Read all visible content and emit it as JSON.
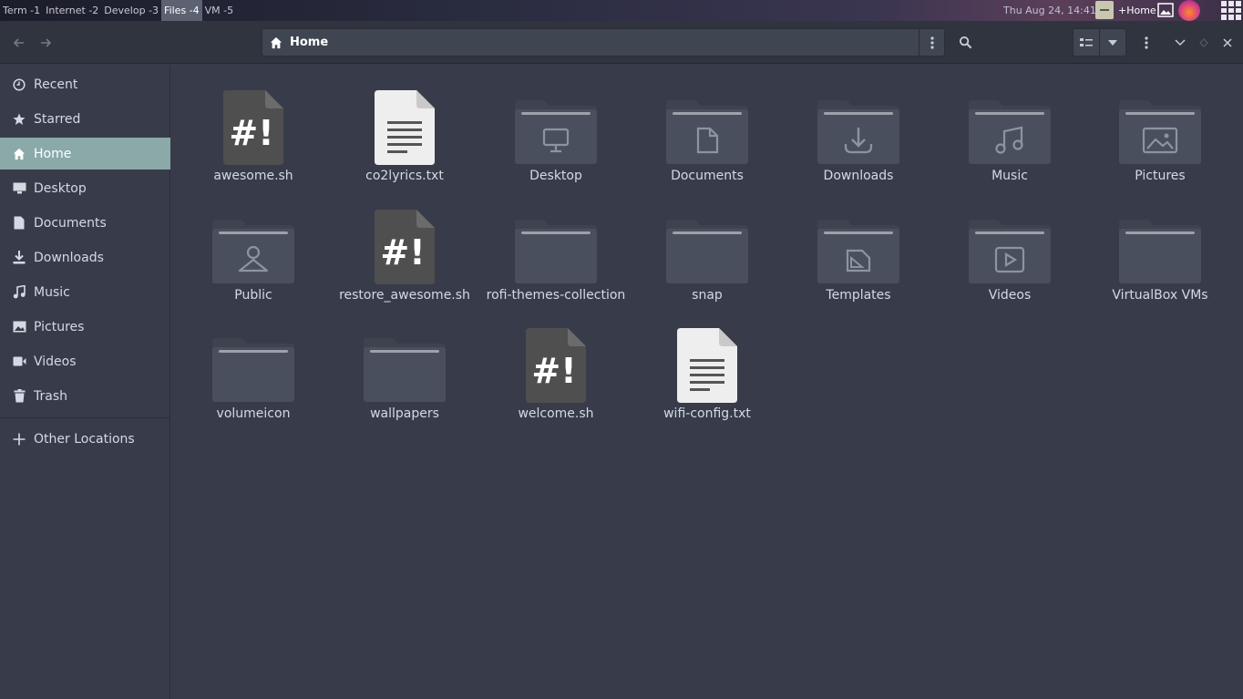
{
  "topbar": {
    "workspaces": [
      "Term -1",
      "Internet -2",
      "Develop -3",
      "Files -4",
      "VM -5"
    ],
    "active_workspace": 3,
    "clock": "Thu Aug 24, 14:41",
    "tray_title": "+Home"
  },
  "header": {
    "path": "Home"
  },
  "sidebar": {
    "items": [
      {
        "label": "Recent",
        "icon": "clock-icon"
      },
      {
        "label": "Starred",
        "icon": "star-icon"
      },
      {
        "label": "Home",
        "icon": "home-icon",
        "active": true
      },
      {
        "label": "Desktop",
        "icon": "desktop-icon"
      },
      {
        "label": "Documents",
        "icon": "document-icon"
      },
      {
        "label": "Downloads",
        "icon": "download-icon"
      },
      {
        "label": "Music",
        "icon": "music-icon"
      },
      {
        "label": "Pictures",
        "icon": "picture-icon"
      },
      {
        "label": "Videos",
        "icon": "video-icon"
      },
      {
        "label": "Trash",
        "icon": "trash-icon"
      }
    ],
    "other_locations": "Other Locations"
  },
  "files": [
    {
      "name": "awesome.sh",
      "kind": "script"
    },
    {
      "name": "co2lyrics.txt",
      "kind": "text"
    },
    {
      "name": "Desktop",
      "kind": "folder",
      "emblem": "desktop"
    },
    {
      "name": "Documents",
      "kind": "folder",
      "emblem": "document"
    },
    {
      "name": "Downloads",
      "kind": "folder",
      "emblem": "download"
    },
    {
      "name": "Music",
      "kind": "folder",
      "emblem": "music"
    },
    {
      "name": "Pictures",
      "kind": "folder",
      "emblem": "picture"
    },
    {
      "name": "Public",
      "kind": "folder",
      "emblem": "public"
    },
    {
      "name": "restore_awesome.sh",
      "kind": "script"
    },
    {
      "name": "rofi-themes-collection",
      "kind": "folder"
    },
    {
      "name": "snap",
      "kind": "folder"
    },
    {
      "name": "Templates",
      "kind": "folder",
      "emblem": "template"
    },
    {
      "name": "Videos",
      "kind": "folder",
      "emblem": "video"
    },
    {
      "name": "VirtualBox VMs",
      "kind": "folder"
    },
    {
      "name": "volumeicon",
      "kind": "folder"
    },
    {
      "name": "wallpapers",
      "kind": "folder"
    },
    {
      "name": "welcome.sh",
      "kind": "script"
    },
    {
      "name": "wifi-config.txt",
      "kind": "text"
    }
  ],
  "colors": {
    "background": "#383c4a",
    "header": "#2f343f",
    "sidebar_active": "#8aa9a8",
    "folder": "#4a4f5d",
    "script": "#4f4f4f",
    "text_file": "#eeeeee"
  }
}
